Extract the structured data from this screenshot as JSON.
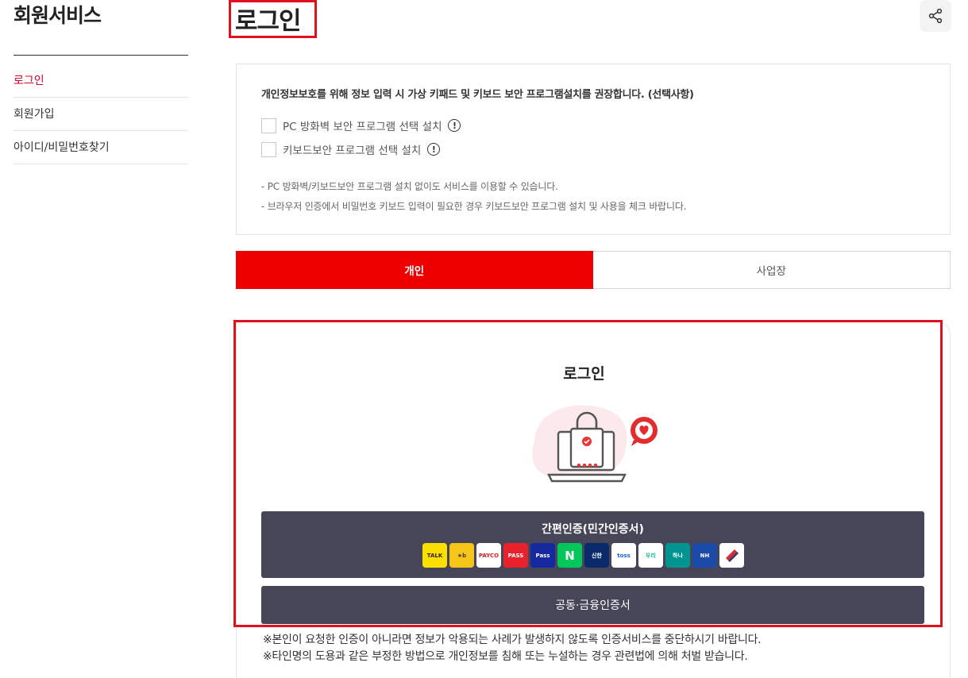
{
  "sidebar": {
    "title": "회원서비스",
    "items": [
      {
        "label": "로그인",
        "active": true
      },
      {
        "label": "회원가입",
        "active": false
      },
      {
        "label": "아이디/비밀번호찾기",
        "active": false
      }
    ]
  },
  "page": {
    "title": "로그인",
    "share_icon": "share-icon"
  },
  "security_notice": {
    "heading": "개인정보보호를 위해 정보 입력 시 가상 키패드 및 키보드 보안 프로그램설치를 권장합니다. (선택사항)",
    "options": [
      {
        "label": "PC 방화벽 보안 프로그램 선택 설치",
        "checked": false
      },
      {
        "label": "키보드보안 프로그램 선택 설치",
        "checked": false
      }
    ],
    "notes": [
      "-  PC 방화벽/키보드보안 프로그램 설치 없이도 서비스를 이용할 수 있습니다.",
      "-  브라우저 인증에서 비밀번호 키보드 입력이 필요한 경우 키보드보안 프로그램 설치 및 사용을 체크 바랍니다."
    ]
  },
  "tabs": [
    {
      "label": "개인",
      "active": true
    },
    {
      "label": "사업장",
      "active": false
    }
  ],
  "login_panel": {
    "title": "로그인",
    "simple_auth_label": "간편인증(민간인증서)",
    "providers": [
      {
        "name": "kakao-talk",
        "text": "TALK",
        "bg": "#f9e000",
        "fg": "#3a1d1d"
      },
      {
        "name": "kb",
        "text": "★b",
        "bg": "#f5c518",
        "fg": "#4a3b2a"
      },
      {
        "name": "payco",
        "text": "PAYCO",
        "bg": "#ffffff",
        "fg": "#e02020"
      },
      {
        "name": "pass",
        "text": "PASS",
        "bg": "#e8212b",
        "fg": "#ffffff"
      },
      {
        "name": "samsung-pass",
        "text": "Pass",
        "bg": "#1428a0",
        "fg": "#ffffff"
      },
      {
        "name": "naver",
        "text": "N",
        "bg": "#03c75a",
        "fg": "#ffffff"
      },
      {
        "name": "shinhan",
        "text": "신한",
        "bg": "#0a2a6b",
        "fg": "#ffffff"
      },
      {
        "name": "toss",
        "text": "toss",
        "bg": "#ffffff",
        "fg": "#1b64da"
      },
      {
        "name": "woori",
        "text": "우리",
        "bg": "#ffffff",
        "fg": "#16b6a3"
      },
      {
        "name": "hana",
        "text": "하나",
        "bg": "#009490",
        "fg": "#ffffff"
      },
      {
        "name": "nh",
        "text": "NH",
        "bg": "#1b4aa8",
        "fg": "#ffffff"
      },
      {
        "name": "bank-card",
        "text": "",
        "bg": "#ffffff",
        "fg": "#d32f2f"
      }
    ],
    "cert_label": "공동·금융인증서"
  },
  "warnings": [
    "※본인이 요청한 인증이 아니라면 정보가 악용되는 사례가 발생하지 않도록 인증서비스를 중단하시기 바랍니다.",
    "※타인명의 도용과 같은 부정한 방법으로 개인정보를 침해 또는 누설하는 경우 관련법에 의해 처벌 받습니다."
  ],
  "colors": {
    "accent_red": "#ee0000",
    "active_menu": "#d7002a",
    "button_dark": "#474558",
    "highlight_frame": "#e1101d"
  }
}
